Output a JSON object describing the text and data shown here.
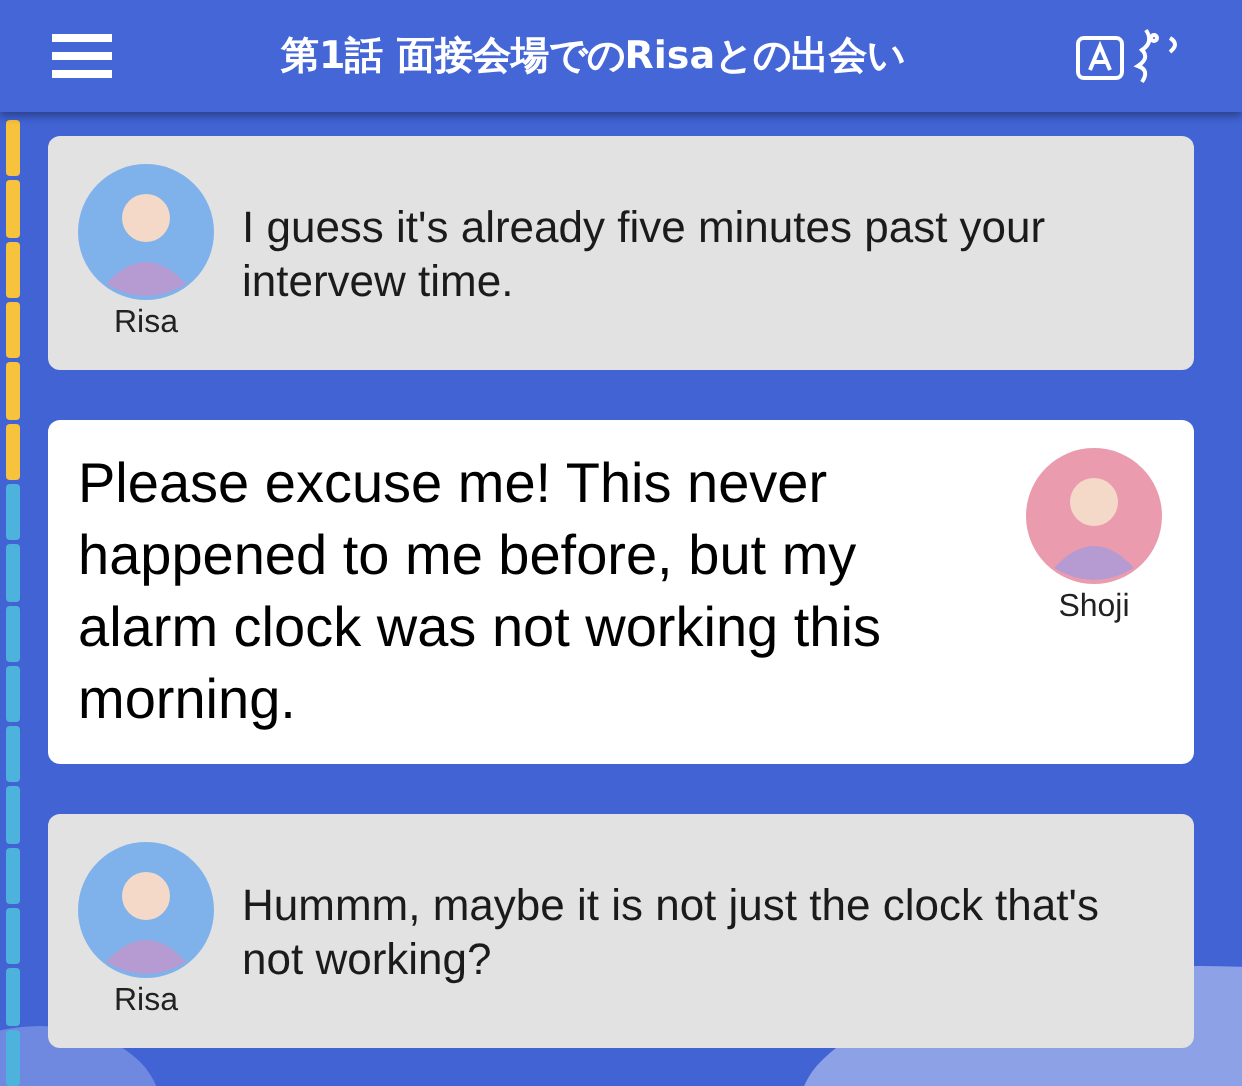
{
  "header": {
    "title": "第1話 面接会場でのRisaとの出会い"
  },
  "progress": {
    "level": 0.36
  },
  "messages": [
    {
      "speaker": "Risa",
      "kind": "left",
      "color": "#7fb2ea",
      "selected": false,
      "text": "I guess it's already five minutes past your intervew time."
    },
    {
      "speaker": "Shoji",
      "kind": "right",
      "color": "#ea9cae",
      "selected": true,
      "text": "Please excuse me! This never happened to me before, but my alarm clock was not working this morning."
    },
    {
      "speaker": "Risa",
      "kind": "left",
      "color": "#7fb2ea",
      "selected": false,
      "text": "Hummm, maybe it is not just the clock that's not working?"
    }
  ]
}
